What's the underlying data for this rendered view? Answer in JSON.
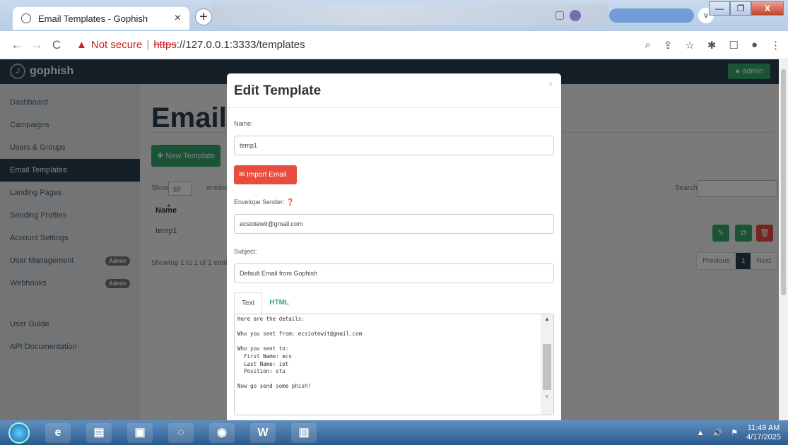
{
  "browser": {
    "tab_title": "Email Templates - Gophish",
    "close_glyph": "×",
    "newtab_glyph": "+",
    "win_min": "—",
    "win_max": "❐",
    "win_close": "X",
    "dropdown_glyph": "v",
    "not_secure": "Not secure",
    "url_scheme": "https",
    "url_rest": "://127.0.0.1:3333/templates",
    "back_glyph": "←",
    "fwd_glyph": "→",
    "reload_glyph": "C",
    "warn_glyph": "▲",
    "sep": "|",
    "right_icons": [
      "⌕",
      "⇪",
      "☆",
      "✱",
      "☐",
      "●",
      "⋮"
    ]
  },
  "navbar": {
    "brand": "gophish",
    "logo_glyph": "J",
    "admin_label": "admin"
  },
  "sidebar": {
    "items": [
      {
        "label": "Dashboard"
      },
      {
        "label": "Campaigns"
      },
      {
        "label": "Users & Groups"
      },
      {
        "label": "Email Templates"
      },
      {
        "label": "Landing Pages"
      },
      {
        "label": "Sending Profiles"
      },
      {
        "label": "Account Settings"
      },
      {
        "label": "User Management",
        "badge": "Admin"
      },
      {
        "label": "Webhooks",
        "badge": "Admin"
      },
      {
        "label": "User Guide"
      },
      {
        "label": "API Documentation"
      }
    ]
  },
  "main": {
    "title": "Email",
    "new_button": "New Template",
    "new_plus": "✚",
    "show_label": "Show",
    "show_value": "10",
    "entries_label": "entries",
    "search_label": "Search:",
    "column_name": "Name",
    "sort_glyph": "▲",
    "rows": [
      {
        "name": "temp1"
      }
    ],
    "actions": {
      "edit": "✎",
      "copy": "⧉",
      "delete": "🗑"
    },
    "showing": "Showing 1 to 1 of 1 entries",
    "pager": {
      "prev": "Previous",
      "current": "1",
      "next": "Next"
    }
  },
  "modal": {
    "title": "Edit Template",
    "close_glyph": "×",
    "name_label": "Name:",
    "name_value": "temp1",
    "import_button": "Import Email",
    "import_glyph": "✉",
    "envelope_label": "Envelope Sender:",
    "help_glyph": "❓",
    "envelope_value": "ecsiotewit@gmail.com",
    "subject_label": "Subject:",
    "subject_value": "Default Email from Gophish",
    "tabs": {
      "text": "Text",
      "html": "HTML"
    },
    "body_text": "Here are the details:\n\nWho you sent from: ecsiotewit@gmail.com\n\nWho you sent to:\n  First Name: ecs\n  Last Name: iot\n  Position: stu\n\nNow go send some phish!",
    "scroll_up": "▲",
    "scroll_down": "▼"
  },
  "taskbar": {
    "apps": [
      "e",
      "▤",
      "▣",
      "◌",
      "◉",
      "W",
      "▥"
    ],
    "tray": [
      "▲",
      "🔊",
      "⚑"
    ],
    "time": "11:49 AM",
    "date": "4/17/2025"
  }
}
